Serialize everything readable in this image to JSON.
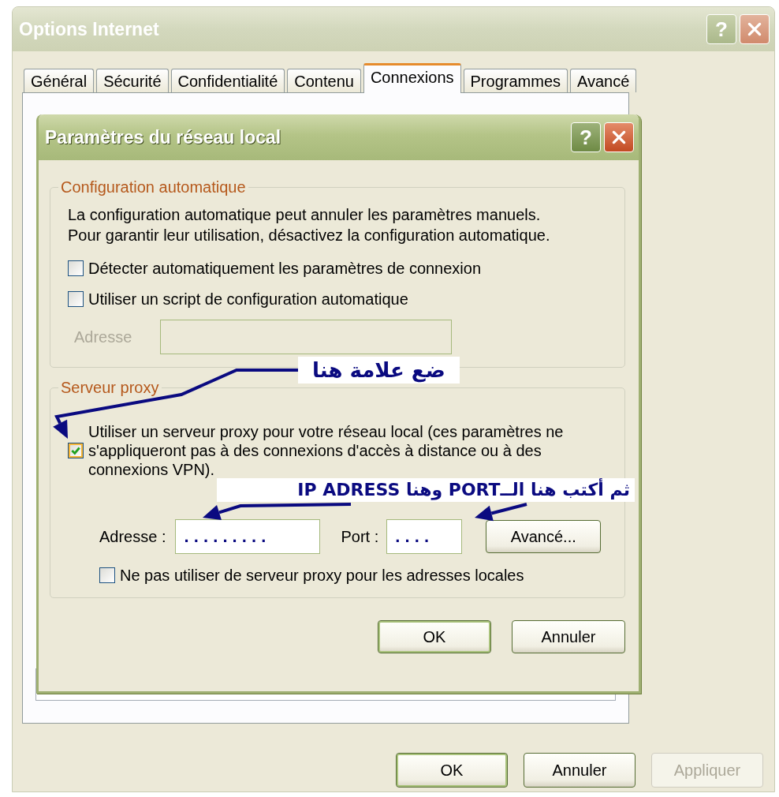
{
  "window": {
    "title": "Options Internet",
    "help": "?"
  },
  "tabs": [
    {
      "label": "Général",
      "selected": false
    },
    {
      "label": "Sécurité",
      "selected": false
    },
    {
      "label": "Confidentialité",
      "selected": false
    },
    {
      "label": "Contenu",
      "selected": false
    },
    {
      "label": "Connexions",
      "selected": true
    },
    {
      "label": "Programmes",
      "selected": false
    },
    {
      "label": "Avancé",
      "selected": false
    }
  ],
  "dialog": {
    "title": "Paramètres du réseau local",
    "help": "?",
    "groups": [
      {
        "title": "Configuration automatique",
        "items": [
          {
            "kind": "text",
            "text": "La configuration automatique peut annuler les paramètres manuels.\nPour garantir leur utilisation, désactivez la configuration automatique."
          },
          {
            "kind": "checkbox",
            "label": "Détecter automatiquement les paramètres de connexion",
            "checked": false
          },
          {
            "kind": "checkbox",
            "label": "Utiliser un script de configuration automatique",
            "checked": false
          },
          {
            "kind": "address",
            "label": "Adresse",
            "disabled": true
          }
        ]
      },
      {
        "title": "Serveur proxy",
        "items": [
          {
            "kind": "checkbox",
            "label": "Utiliser un serveur proxy pour votre réseau local (ces paramètres ne s'appliqueront pas à des connexions d'accès à distance ou à des connexions VPN).",
            "checked": true
          },
          {
            "kind": "proxy",
            "address_label": "Adresse :",
            "address_value": ". . . . . . . . .",
            "port_label": "Port :",
            "port_value": ". . . .",
            "button": "Avancé..."
          },
          {
            "kind": "checkbox",
            "label": "Ne pas utiliser de serveur proxy pour les adresses locales",
            "checked": false
          }
        ]
      }
    ],
    "buttons": [
      {
        "label": "OK",
        "default": true
      },
      {
        "label": "Annuler",
        "default": false
      }
    ]
  },
  "buttons": [
    {
      "label": "OK",
      "default": true,
      "disabled": false
    },
    {
      "label": "Annuler",
      "default": false,
      "disabled": false
    },
    {
      "label": "Appliquer",
      "default": false,
      "disabled": true
    }
  ],
  "annotations": [
    {
      "text": "ضع علامة هنا"
    },
    {
      "text": "ثم  أكتب هنا الــPORT وهنا IP ADRESS"
    }
  ]
}
